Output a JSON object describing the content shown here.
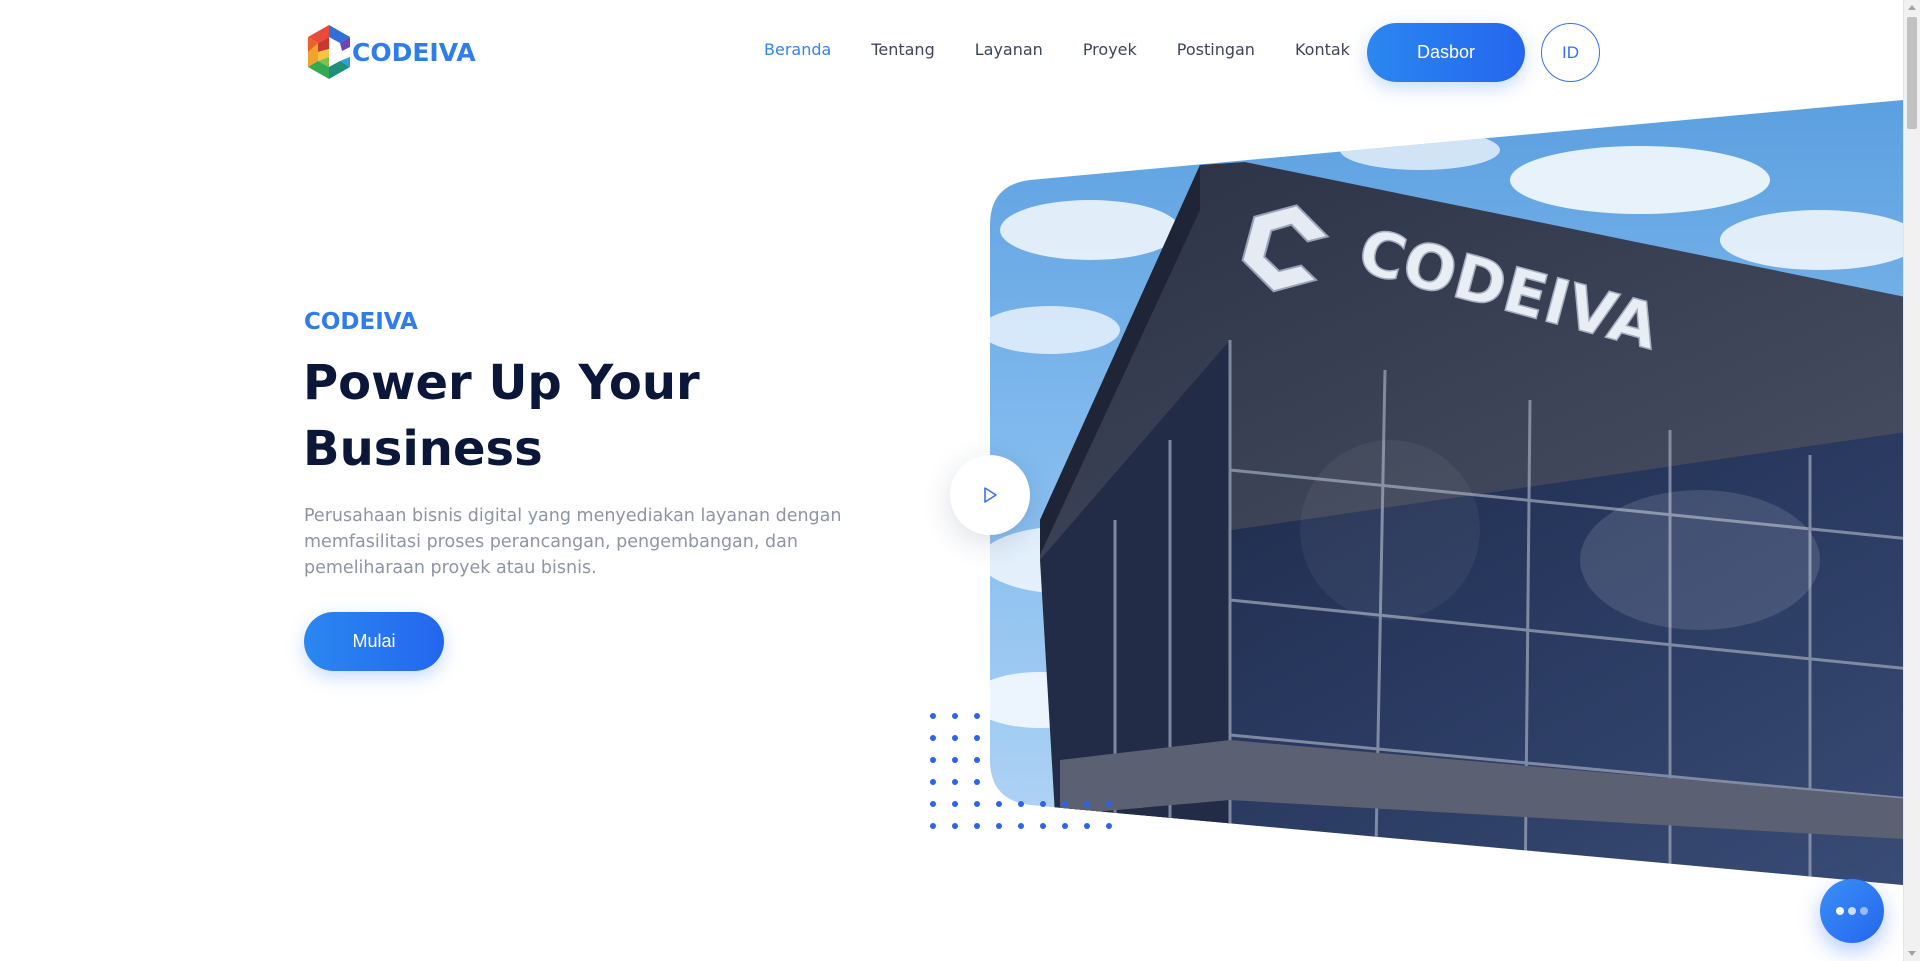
{
  "header": {
    "logo_text": "CODEIVA",
    "nav": [
      {
        "label": "Beranda",
        "active": true
      },
      {
        "label": "Tentang",
        "active": false
      },
      {
        "label": "Layanan",
        "active": false
      },
      {
        "label": "Proyek",
        "active": false
      },
      {
        "label": "Postingan",
        "active": false
      },
      {
        "label": "Kontak",
        "active": false
      }
    ],
    "dashboard_label": "Dasbor",
    "language_label": "ID"
  },
  "hero": {
    "eyebrow": "CODEIVA",
    "title_line1": "Power Up Your",
    "title_line2": "Business",
    "description": "Perusahaan bisnis digital yang menyediakan layanan dengan memfasilitasi proses perancangan, pengembangan, dan pemeliharaan proyek atau bisnis.",
    "cta_label": "Mulai",
    "building_sign": "CODEIVA"
  },
  "icons": {
    "play": "play-icon",
    "chat": "chat-icon"
  },
  "colors": {
    "accent": "#2f7de9",
    "button_gradient_start": "#2b87f0",
    "button_gradient_end": "#2466ef",
    "heading": "#0b1739",
    "body_text": "#8d95a3"
  }
}
